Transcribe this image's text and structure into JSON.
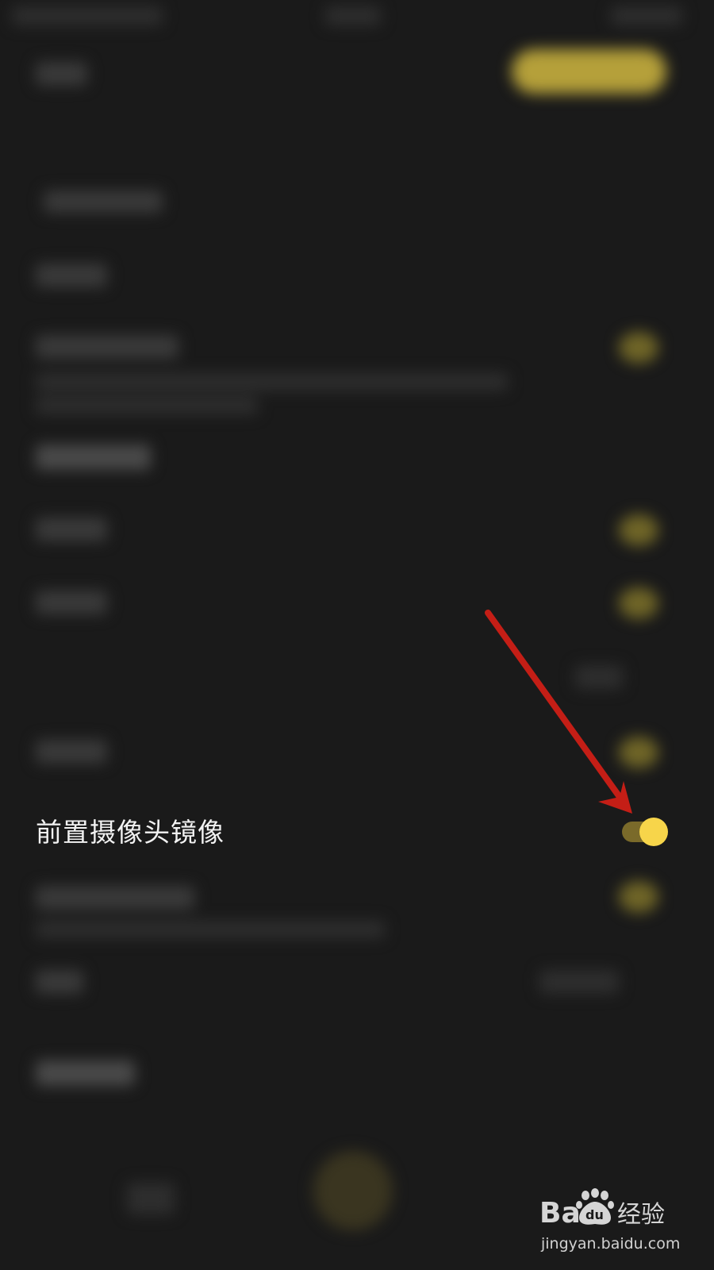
{
  "settings": {
    "front_camera_mirror": {
      "label": "前置摄像头镜像",
      "enabled": true
    }
  },
  "watermark": {
    "brand": "Baidu经验",
    "url": "jingyan.baidu.com"
  },
  "colors": {
    "background": "#1a1a1a",
    "toggle_track_on": "#7a6a2a",
    "toggle_knob_on": "#f7d54a",
    "annotation_arrow": "#c41e16",
    "accent_yellow": "#b5a03a"
  },
  "icons": {
    "annotation": "red-arrow-icon",
    "watermark_logo": "baidu-paw-icon"
  }
}
